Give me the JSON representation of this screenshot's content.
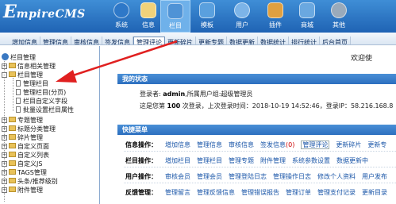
{
  "header": {
    "logo_big": "E",
    "logo_rest": "mpireCMS",
    "nav": [
      {
        "label": "系统",
        "icon": "gear-globe-icon",
        "color": "#2e78c8"
      },
      {
        "label": "信息",
        "icon": "notepad-icon",
        "color": "#e2b45a"
      },
      {
        "label": "栏目",
        "icon": "columns-icon",
        "color": "#4f93d6"
      },
      {
        "label": "模板",
        "icon": "template-icon",
        "color": "#5aa0de"
      },
      {
        "label": "用户",
        "icon": "user-icon",
        "color": "#7cb4e8"
      },
      {
        "label": "插件",
        "icon": "tools-icon",
        "color": "#e0a040"
      },
      {
        "label": "商城",
        "icon": "shop-icon",
        "color": "#6aa8e0"
      },
      {
        "label": "其他",
        "icon": "gear-icon",
        "color": "#9ab"
      }
    ]
  },
  "subnav": [
    "增加信息",
    "管理信息",
    "审核信息",
    "签发信息",
    "管理评论",
    "更新碎片",
    "更新专题",
    "数据更新",
    "数据统计",
    "排行统计",
    "后台首页"
  ],
  "tree": {
    "items": [
      {
        "label": "栏目管理",
        "kind": "root"
      },
      {
        "label": "信息相关管理",
        "kind": "folder",
        "pm": "+"
      },
      {
        "label": "栏目管理",
        "kind": "folder",
        "pm": "-"
      },
      {
        "label": "管理栏目",
        "kind": "doc"
      },
      {
        "label": "管理栏目(分页)",
        "kind": "doc"
      },
      {
        "label": "栏目自定义字段",
        "kind": "doc"
      },
      {
        "label": "批量设置栏目属性",
        "kind": "doc"
      },
      {
        "label": "专题管理",
        "kind": "folder",
        "pm": "+"
      },
      {
        "label": "标题分类管理",
        "kind": "folder",
        "pm": "+"
      },
      {
        "label": "碎片管理",
        "kind": "folder",
        "pm": "+"
      },
      {
        "label": "自定义页面",
        "kind": "folder",
        "pm": "+"
      },
      {
        "label": "自定义列表",
        "kind": "folder",
        "pm": "+"
      },
      {
        "label": "自定义JS",
        "kind": "folder",
        "pm": "+"
      },
      {
        "label": "TAGS管理",
        "kind": "folder",
        "pm": "+"
      },
      {
        "label": "头条/推荐级别",
        "kind": "folder",
        "pm": "+"
      },
      {
        "label": "附件管理",
        "kind": "folder",
        "pm": "+"
      }
    ]
  },
  "main": {
    "welcome": "欢迎使",
    "status_title": "我的状态",
    "login_prefix": "登录者:",
    "login_user": "admin",
    "login_group_prefix": ",所属用户组:",
    "login_group": "超级管理员",
    "login_count_prefix": "这是您第",
    "login_count": "100",
    "login_count_suffix": "次登录，上次登录时间：",
    "last_login_time": "2018-10-19 14:52:46",
    "ip_prefix": "，登录IP：",
    "ip": "58.216.168.8",
    "quick_title": "快捷菜单",
    "rows": [
      {
        "label": "信息操作：",
        "links": [
          "增加信息",
          "管理信息",
          "审核信息",
          "签发信息",
          "(0)",
          "管理评论",
          "更新碎片",
          "更新专"
        ]
      },
      {
        "label": "栏目操作：",
        "links": [
          "增加栏目",
          "管理栏目",
          "管理专题",
          "附件管理",
          "系统参数设置",
          "数据更新中"
        ]
      },
      {
        "label": "用户操作：",
        "links": [
          "审核会员",
          "管理会员",
          "管理登陆日志",
          "管理操作日志",
          "修改个人资料",
          "用户发布"
        ]
      },
      {
        "label": "反馈管理：",
        "links": [
          "管理留言",
          "管理反馈信息",
          "管理错误报告",
          "管理订单",
          "管理支付记录",
          "更新目录"
        ]
      }
    ]
  }
}
